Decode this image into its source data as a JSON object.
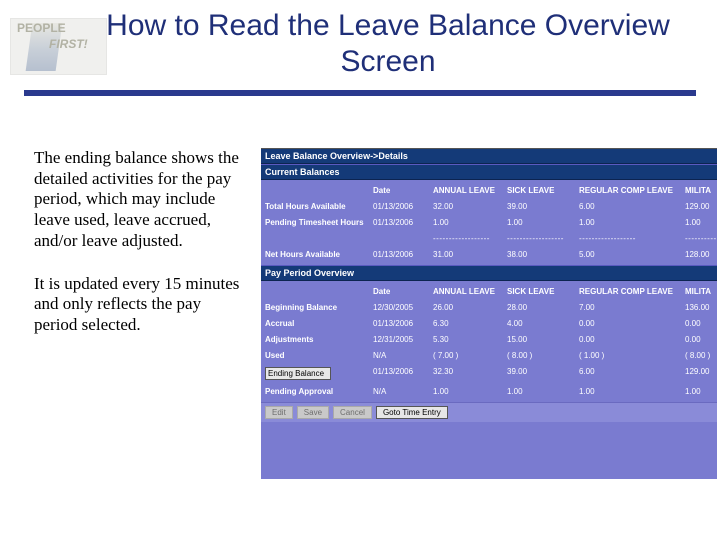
{
  "logo": {
    "line1": "PEOPLE",
    "line2": "FIRST!"
  },
  "title": "How to Read the Leave Balance Overview Screen",
  "paragraphs": [
    "The ending balance shows the detailed activities for the pay period, which may include leave used, leave accrued, and/or leave adjusted.",
    "It is updated every 15 minutes and only reflects the pay period selected."
  ],
  "screenshot": {
    "window_title": "Leave Balance Overview->Details",
    "section_current": "Current Balances",
    "section_pay": "Pay Period Overview",
    "headers": [
      "",
      "Date",
      "ANNUAL LEAVE",
      "SICK LEAVE",
      "REGULAR COMP LEAVE",
      "MILITA"
    ],
    "current_rows": [
      {
        "label": "Total Hours Available",
        "cells": [
          "01/13/2006",
          "32.00",
          "39.00",
          "6.00",
          "129.00"
        ]
      },
      {
        "label": "Pending Timesheet Hours",
        "cells": [
          "01/13/2006",
          "1.00",
          "1.00",
          "1.00",
          "1.00"
        ]
      },
      {
        "label": "",
        "cells": [
          "",
          "------------------",
          "------------------",
          "------------------",
          "------------------"
        ]
      },
      {
        "label": "Net Hours Available",
        "cells": [
          "01/13/2006",
          "31.00",
          "38.00",
          "5.00",
          "128.00"
        ]
      }
    ],
    "pay_rows": [
      {
        "label": "Beginning Balance",
        "cells": [
          "12/30/2005",
          "26.00",
          "28.00",
          "7.00",
          "136.00"
        ]
      },
      {
        "label": "Accrual",
        "cells": [
          "01/13/2006",
          "6.30",
          "4.00",
          "0.00",
          "0.00"
        ]
      },
      {
        "label": "Adjustments",
        "cells": [
          "12/31/2005",
          "5.30",
          "15.00",
          "0.00",
          "0.00"
        ]
      },
      {
        "label": "Used",
        "cells": [
          "N/A",
          "( 7.00 )",
          "( 8.00 )",
          "( 1.00 )",
          "( 8.00 )"
        ]
      },
      {
        "label": "Ending Balance",
        "cells": [
          "01/13/2006",
          "32.30",
          "39.00",
          "6.00",
          "129.00"
        ],
        "highlight": true
      },
      {
        "label": "Pending Approval",
        "cells": [
          "N/A",
          "1.00",
          "1.00",
          "1.00",
          "1.00"
        ]
      }
    ],
    "buttons": {
      "edit": "Edit",
      "save": "Save",
      "cancel": "Cancel",
      "goto": "Goto Time Entry"
    }
  }
}
